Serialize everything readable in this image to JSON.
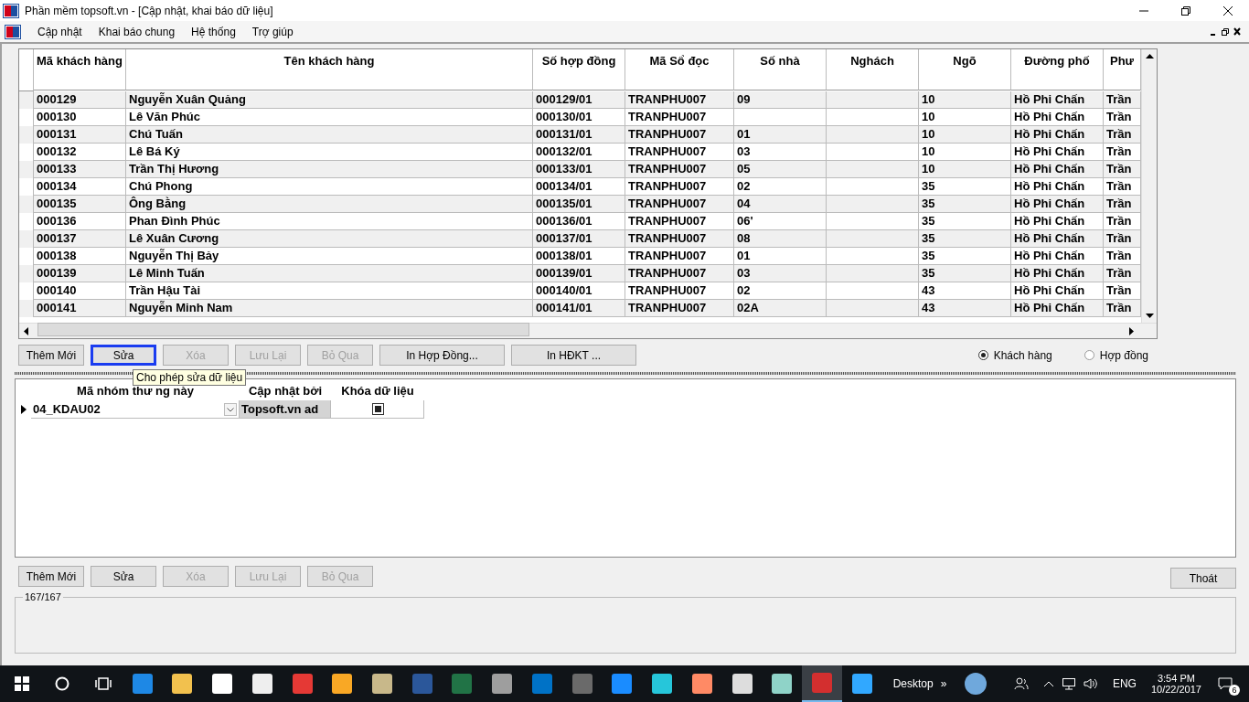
{
  "window": {
    "title": "Phần mềm topsoft.vn - [Cập nhật, khai báo dữ liệu]"
  },
  "menu": [
    "Cập nhật",
    "Khai báo chung",
    "Hệ thống",
    "Trợ giúp"
  ],
  "top_grid": {
    "columns": [
      "Mã khách hàng",
      "Tên khách hàng",
      "Số hợp đồng",
      "Mã Sổ đọc",
      "Số nhà",
      "Nghách",
      "Ngõ",
      "Đường phố",
      "Phư"
    ],
    "rows": [
      [
        "000129",
        "Nguyễn Xuân Quảng",
        "000129/01",
        "TRANPHU007",
        "09",
        "",
        "10",
        "Hồ Phi Chấn",
        "Trần"
      ],
      [
        "000130",
        "Lê Văn Phúc",
        "000130/01",
        "TRANPHU007",
        "",
        "",
        "10",
        "Hồ Phi Chấn",
        "Trần"
      ],
      [
        "000131",
        "Chú Tuấn",
        "000131/01",
        "TRANPHU007",
        "01",
        "",
        "10",
        "Hồ Phi Chấn",
        "Trần"
      ],
      [
        "000132",
        "Lê Bá Ký",
        "000132/01",
        "TRANPHU007",
        "03",
        "",
        "10",
        "Hồ Phi Chấn",
        "Trần"
      ],
      [
        "000133",
        "Trần Thị Hương",
        "000133/01",
        "TRANPHU007",
        "05",
        "",
        "10",
        "Hồ Phi Chấn",
        "Trần"
      ],
      [
        "000134",
        "Chú Phong",
        "000134/01",
        "TRANPHU007",
        "02",
        "",
        "35",
        "Hồ Phi Chấn",
        "Trần"
      ],
      [
        "000135",
        "Ông Bằng",
        "000135/01",
        "TRANPHU007",
        "04",
        "",
        "35",
        "Hồ Phi Chấn",
        "Trần"
      ],
      [
        "000136",
        "Phan Đình Phúc",
        "000136/01",
        "TRANPHU007",
        "06'",
        "",
        "35",
        "Hồ Phi Chấn",
        "Trần"
      ],
      [
        "000137",
        "Lê Xuân Cương",
        "000137/01",
        "TRANPHU007",
        "08",
        "",
        "35",
        "Hồ Phi Chấn",
        "Trần"
      ],
      [
        "000138",
        "Nguyễn Thị Bảy",
        "000138/01",
        "TRANPHU007",
        "01",
        "",
        "35",
        "Hồ Phi Chấn",
        "Trần"
      ],
      [
        "000139",
        "Lê Minh Tuấn",
        "000139/01",
        "TRANPHU007",
        "03",
        "",
        "35",
        "Hồ Phi Chấn",
        "Trần"
      ],
      [
        "000140",
        "Trần Hậu Tài",
        "000140/01",
        "TRANPHU007",
        "02",
        "",
        "43",
        "Hồ Phi Chấn",
        "Trần"
      ],
      [
        "000141",
        "Nguyễn Minh Nam",
        "000141/01",
        "TRANPHU007",
        "02A",
        "",
        "43",
        "Hồ Phi Chấn",
        "Trần"
      ]
    ]
  },
  "top_buttons": [
    {
      "label": "Thêm Mới",
      "disabled": false,
      "focused": false
    },
    {
      "label": "Sửa",
      "disabled": false,
      "focused": true
    },
    {
      "label": "Xóa",
      "disabled": true,
      "focused": false
    },
    {
      "label": "Lưu Lại",
      "disabled": true,
      "focused": false
    },
    {
      "label": "Bỏ Qua",
      "disabled": true,
      "focused": false
    },
    {
      "label": "In Hợp Đồng...",
      "disabled": false,
      "focused": false
    },
    {
      "label": "In HĐKT ...",
      "disabled": false,
      "focused": false
    }
  ],
  "radios": [
    {
      "label": "Khách hàng",
      "selected": true
    },
    {
      "label": "Hợp đồng",
      "selected": false
    }
  ],
  "tooltip": "Cho phép sửa dữ liệu",
  "lower_grid": {
    "columns": [
      "Mã nhóm thư ng này",
      "Cập nhật bởi",
      "Khóa dữ liệu"
    ],
    "rows": [
      {
        "current": true,
        "group": "04_KDAU02",
        "updated_by": "Topsoft.vn ad",
        "locked": true
      }
    ]
  },
  "bottom_buttons": [
    {
      "label": "Thêm Mới",
      "disabled": false
    },
    {
      "label": "Sửa",
      "disabled": false
    },
    {
      "label": "Xóa",
      "disabled": true
    },
    {
      "label": "Lưu Lại",
      "disabled": true
    },
    {
      "label": "Bỏ Qua",
      "disabled": true
    }
  ],
  "exit_button": "Thoát",
  "record_count": "167/167",
  "taskbar": {
    "apps": [
      {
        "color": "#1e88e5",
        "selected": false
      },
      {
        "color": "#f2c14e",
        "selected": false
      },
      {
        "color": "#ffffff",
        "selected": false
      },
      {
        "color": "#eeeeee",
        "selected": false
      },
      {
        "color": "#e53935",
        "selected": false
      },
      {
        "color": "#f9a825",
        "selected": false
      },
      {
        "color": "#c8b88a",
        "selected": false
      },
      {
        "color": "#2b579a",
        "selected": false
      },
      {
        "color": "#217346",
        "selected": false
      },
      {
        "color": "#9e9e9e",
        "selected": false
      },
      {
        "color": "#0072c6",
        "selected": false
      },
      {
        "color": "#6a6a6a",
        "selected": false
      },
      {
        "color": "#1a8cff",
        "selected": false
      },
      {
        "color": "#26c6da",
        "selected": false
      },
      {
        "color": "#ff8a65",
        "selected": false
      },
      {
        "color": "#dddddd",
        "selected": false
      },
      {
        "color": "#8fd3c8",
        "selected": false
      },
      {
        "color": "#d32f2f",
        "selected": true
      },
      {
        "color": "#31a8ff",
        "selected": false
      }
    ],
    "desktop": "Desktop",
    "chevron": "»",
    "language": "ENG",
    "time": "3:54 PM",
    "date": "10/22/2017",
    "notifications": "6"
  }
}
